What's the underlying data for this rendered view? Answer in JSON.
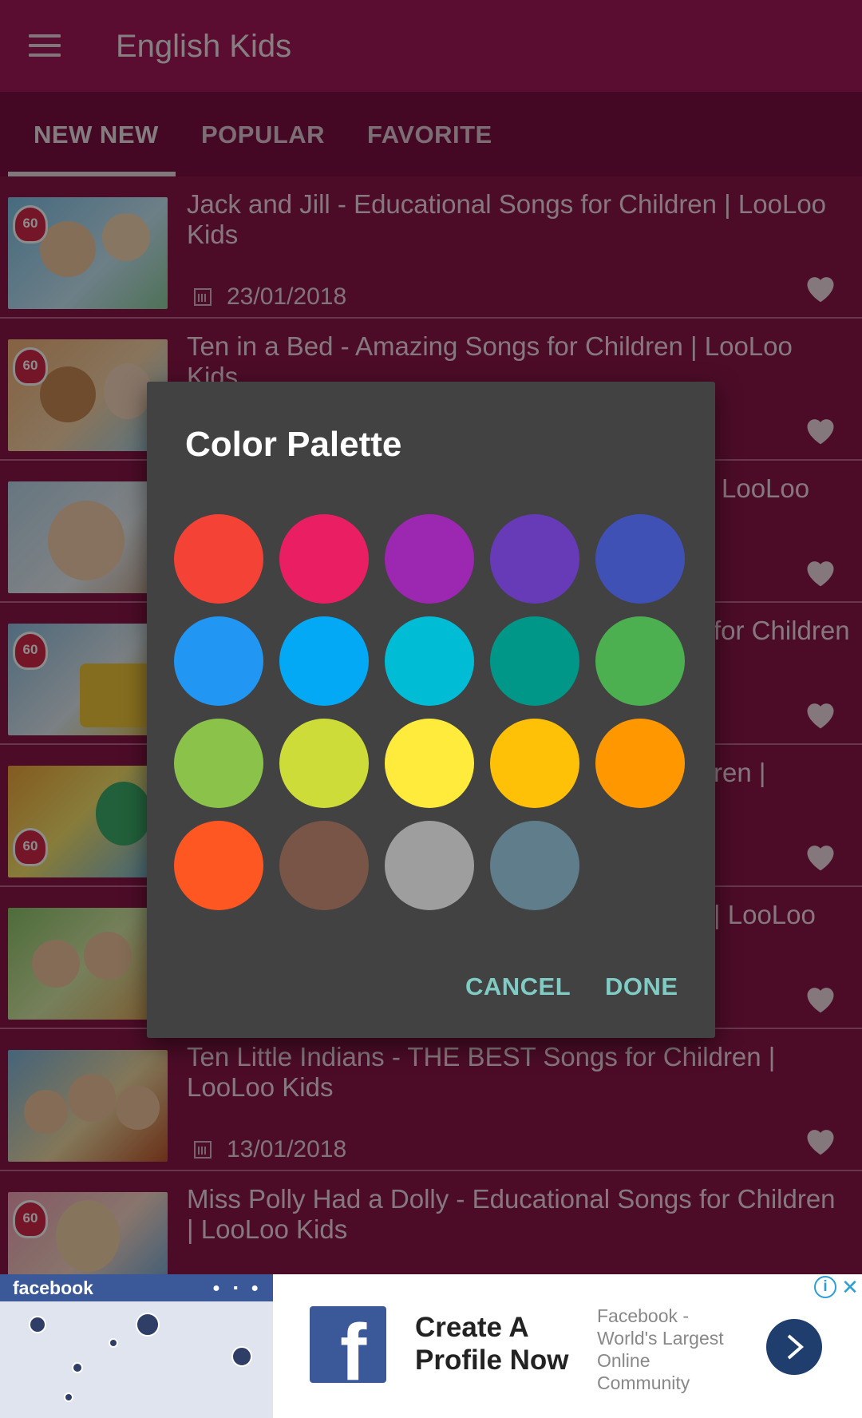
{
  "app_bar": {
    "title": "English Kids",
    "menu_icon": "hamburger-menu-icon"
  },
  "tabs": [
    {
      "label": "NEW NEW",
      "active": true
    },
    {
      "label": "POPULAR",
      "active": false
    },
    {
      "label": "FAVORITE",
      "active": false
    }
  ],
  "videos": [
    {
      "title": "Jack and Jill - Educational Songs for Children | LooLoo Kids",
      "date": "23/01/2018",
      "badge": "60"
    },
    {
      "title": "Ten in a Bed - Amazing Songs for Children | LooLoo Kids",
      "date": "",
      "badge": "60"
    },
    {
      "title": "LooLoo",
      "date": "",
      "badge": ""
    },
    {
      "title": "for Children",
      "date": "",
      "badge": "60"
    },
    {
      "title": "ren |",
      "date": "",
      "badge": "60"
    },
    {
      "title": "| LooLoo",
      "date": "",
      "badge": ""
    },
    {
      "title": "Ten Little Indians - THE BEST Songs for Children | LooLoo Kids",
      "date": "13/01/2018",
      "badge": ""
    },
    {
      "title": "Miss Polly Had a Dolly - Educational Songs for Children | LooLoo Kids",
      "date": "",
      "badge": "60"
    }
  ],
  "dialog": {
    "title": "Color Palette",
    "colors": [
      "#f44336",
      "#e91e63",
      "#9c27b0",
      "#673ab7",
      "#3f51b5",
      "#2196f3",
      "#03a9f4",
      "#00bcd4",
      "#009688",
      "#4caf50",
      "#8bc34a",
      "#cddc39",
      "#ffeb3b",
      "#ffc107",
      "#ff9800",
      "#ff5722",
      "#795548",
      "#9e9e9e",
      "#607d8b"
    ],
    "cancel_label": "CANCEL",
    "done_label": "DONE"
  },
  "ad": {
    "brand": "facebook",
    "headline": "Create A Profile Now",
    "description": "Facebook - World's Largest Online Community"
  }
}
